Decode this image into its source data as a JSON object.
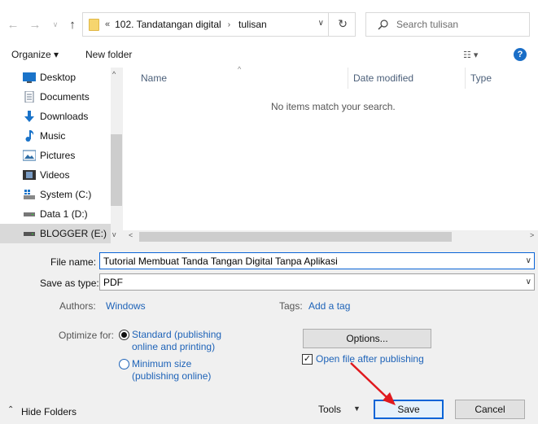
{
  "nav": {
    "back_glyph": "←",
    "forward_glyph": "→",
    "recent_glyph": "∨",
    "up_glyph": "↑"
  },
  "address": {
    "prefix": "«",
    "parts": [
      "102. Tandatangan digital",
      "tulisan"
    ],
    "separator": "›",
    "dropdown_glyph": "∨",
    "refresh_glyph": "↻"
  },
  "search": {
    "placeholder": "Search tulisan"
  },
  "toolbar": {
    "organize_label": "Organize ▾",
    "new_folder_label": "New folder",
    "view_label": "☷ ▾",
    "help_label": "?"
  },
  "sidebar": {
    "items": [
      {
        "label": "Desktop",
        "icon": "desktop-icon",
        "color": "#1a73c9"
      },
      {
        "label": "Documents",
        "icon": "documents-icon",
        "color": "#6a7a8c"
      },
      {
        "label": "Downloads",
        "icon": "downloads-icon",
        "color": "#1a73c9"
      },
      {
        "label": "Music",
        "icon": "music-icon",
        "color": "#1a73c9"
      },
      {
        "label": "Pictures",
        "icon": "pictures-icon",
        "color": "#2f6ea6"
      },
      {
        "label": "Videos",
        "icon": "videos-icon",
        "color": "#333"
      },
      {
        "label": "System (C:)",
        "icon": "drive-icon",
        "color": "#555"
      },
      {
        "label": "Data 1 (D:)",
        "icon": "drive-icon",
        "color": "#555"
      },
      {
        "label": "BLOGGER (E:)",
        "icon": "drive-icon",
        "color": "#555"
      }
    ],
    "scroll_up": "^",
    "scroll_down": "v"
  },
  "filelist": {
    "columns": [
      "Name",
      "Date modified",
      "Type"
    ],
    "sort_glyph": "^",
    "empty_message": "No items match your search.",
    "scroll_left": "<",
    "scroll_right": ">"
  },
  "form": {
    "file_name_label": "File name:",
    "file_name_value": "Tutorial Membuat Tanda Tangan Digital Tanpa Aplikasi",
    "save_as_type_label": "Save as type:",
    "save_as_type_value": "PDF",
    "authors_label": "Authors:",
    "authors_value": "Windows",
    "tags_label": "Tags:",
    "tags_value": "Add a tag",
    "optimize_label": "Optimize for:",
    "optimize_standard": "Standard (publishing online and printing)",
    "optimize_minimum": "Minimum size (publishing online)",
    "options_button": "Options...",
    "open_after_label": "Open file after publishing",
    "open_after_checked": true
  },
  "footer": {
    "hide_folders_label": "Hide Folders",
    "tools_label": "Tools",
    "save_label": "Save",
    "cancel_label": "Cancel"
  },
  "colors": {
    "accent": "#0a64d7",
    "link": "#1e63b8",
    "annotation_arrow": "#e0191e"
  }
}
